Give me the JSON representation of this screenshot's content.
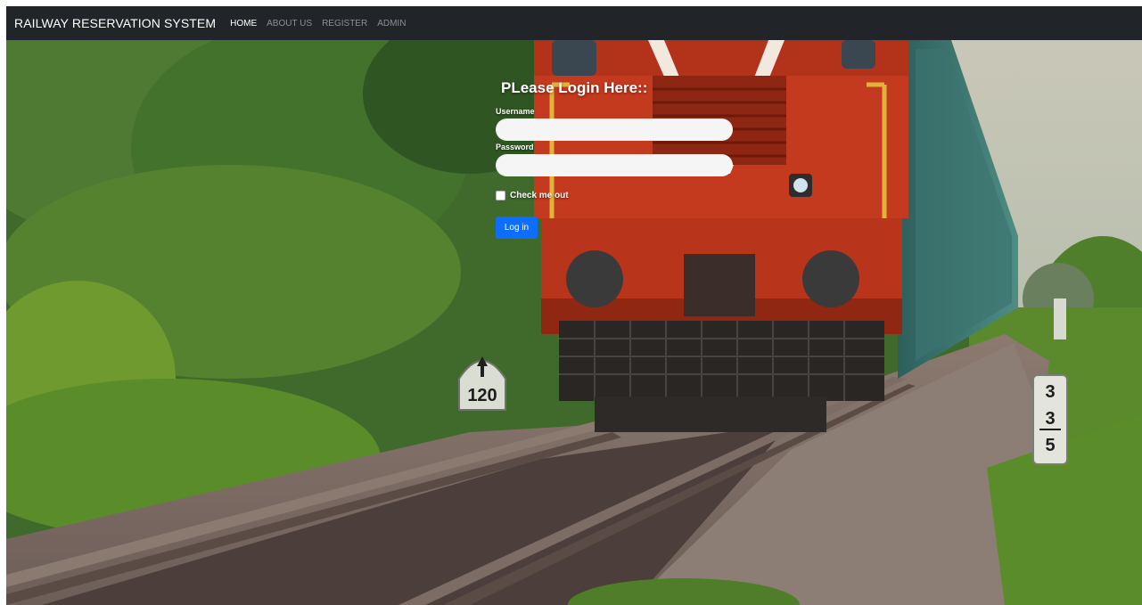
{
  "navbar": {
    "brand": "RAILWAY RESERVATION SYSTEM",
    "links": [
      {
        "label": "HOME",
        "active": true
      },
      {
        "label": "ABOUT US",
        "active": false
      },
      {
        "label": "REGISTER",
        "active": false
      },
      {
        "label": "ADMIN",
        "active": false
      }
    ]
  },
  "login": {
    "heading": "PLease Login Here::",
    "username_label": "Username",
    "username_value": "",
    "password_label": "Password",
    "password_value": "",
    "remember_label": "Check me out",
    "remember_checked": false,
    "submit_label": "Log in"
  },
  "background": {
    "milestone_left": "120",
    "milestone_right_digits": [
      "3",
      "3",
      "5"
    ]
  },
  "colors": {
    "navbar_bg": "#212529",
    "button_primary": "#0d6efd",
    "locomotive_red": "#c43a1f"
  }
}
